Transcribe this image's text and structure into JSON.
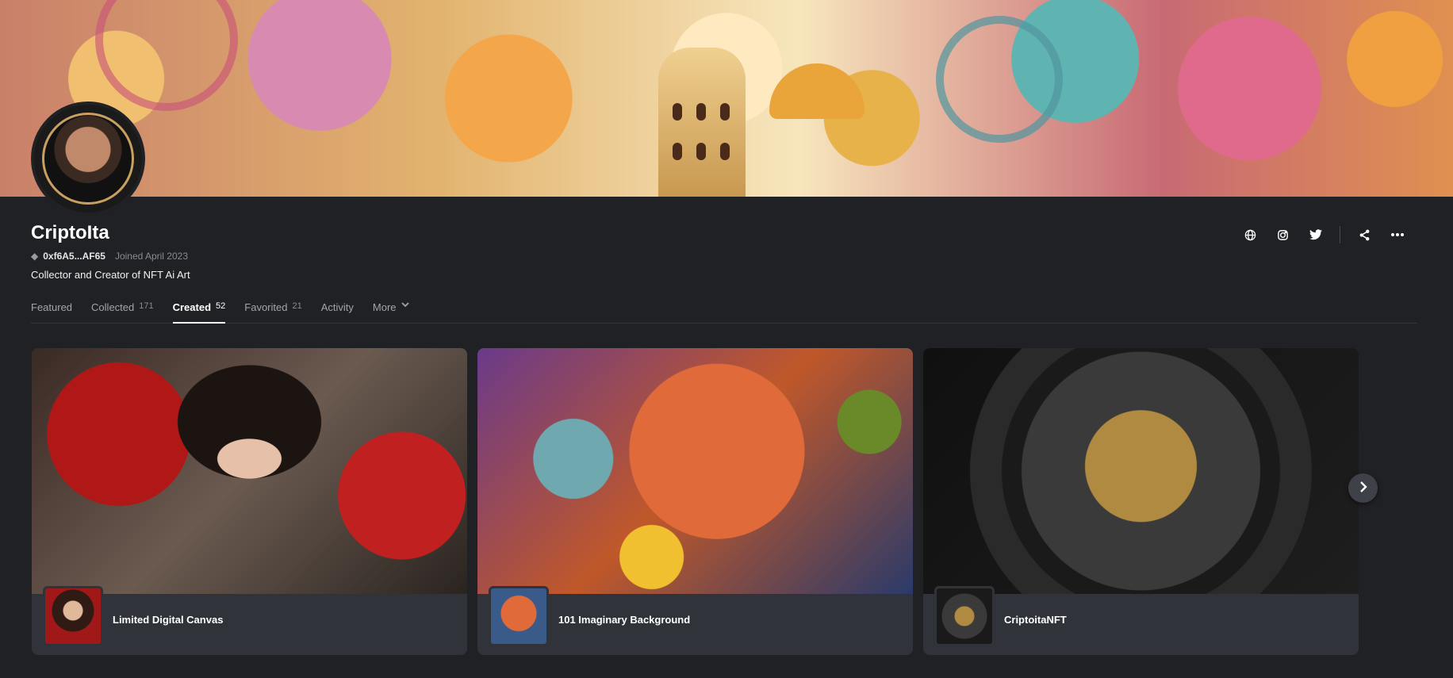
{
  "profile": {
    "name": "CriptoIta",
    "address": "0xf6A5...AF65",
    "joined": "Joined April 2023",
    "bio": "Collector and Creator of NFT Ai Art"
  },
  "actions": {
    "icons": [
      "globe-icon",
      "instagram-icon",
      "twitter-icon",
      "share-icon",
      "more-icon"
    ]
  },
  "tabs": [
    {
      "label": "Featured",
      "count": ""
    },
    {
      "label": "Collected",
      "count": "171"
    },
    {
      "label": "Created",
      "count": "52"
    },
    {
      "label": "Favorited",
      "count": "21"
    },
    {
      "label": "Activity",
      "count": ""
    },
    {
      "label": "More",
      "count": ""
    }
  ],
  "active_tab": "Created",
  "collections": [
    {
      "title": "Limited Digital Canvas"
    },
    {
      "title": "101 Imaginary Background"
    },
    {
      "title": "CriptoitaNFT"
    }
  ]
}
